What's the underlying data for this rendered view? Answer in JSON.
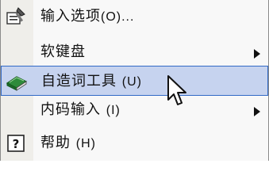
{
  "menu": {
    "items": [
      {
        "label": "输入选项",
        "accel": "(O)...",
        "icon": "input-options-icon",
        "selected": false,
        "submenu": false
      },
      {
        "label": "软键盘",
        "accel": "",
        "icon": "",
        "selected": false,
        "submenu": true
      },
      {
        "label": "自造词工具",
        "accel": "(U)",
        "icon": "book-icon",
        "selected": true,
        "submenu": false
      },
      {
        "label": "内码输入",
        "accel": "(I)",
        "icon": "",
        "selected": false,
        "submenu": true
      },
      {
        "label": "帮助",
        "accel": "(H)",
        "icon": "help-icon",
        "selected": false,
        "submenu": false
      }
    ]
  },
  "colors": {
    "selection_fill": "#c6d3ef",
    "selection_border": "#3169c6",
    "menu_background": "#f8f8f8",
    "icon_gutter": "#efeeea"
  },
  "cursor": {
    "icon": "mouse-pointer-icon"
  }
}
